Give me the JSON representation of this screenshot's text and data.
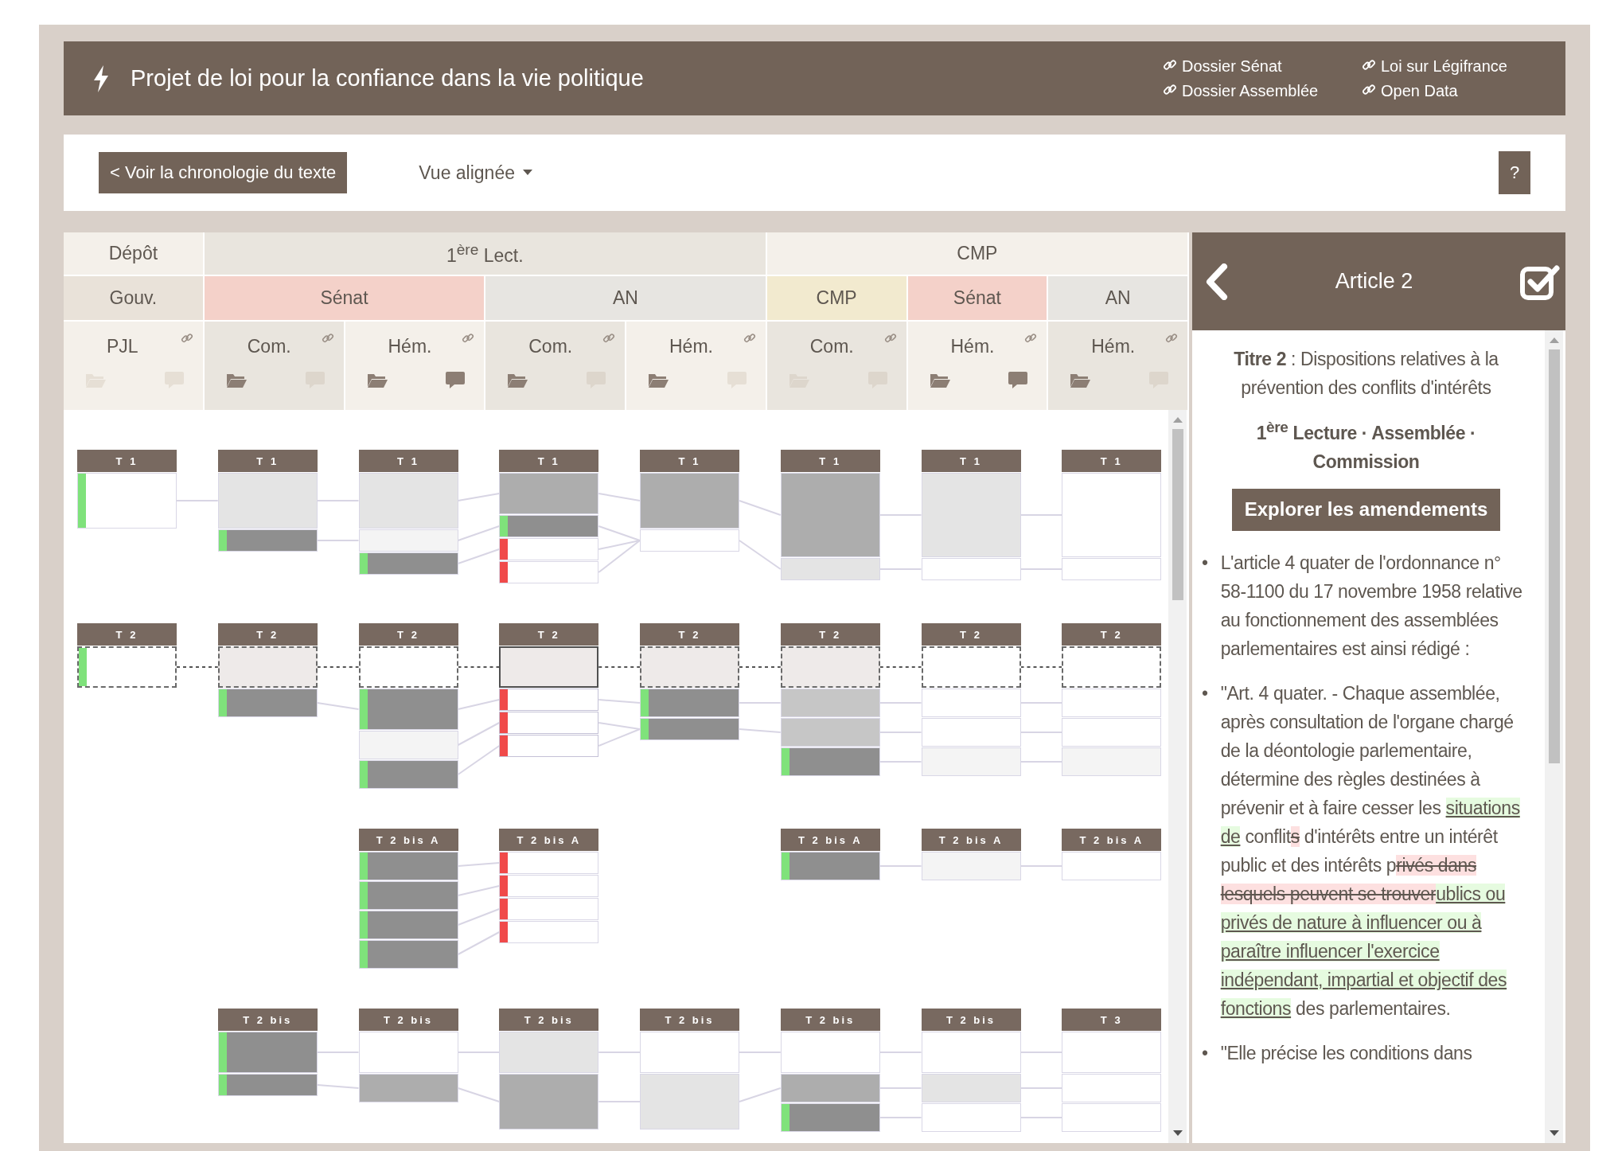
{
  "header": {
    "title": "Projet de loi pour la confiance dans la vie politique",
    "links": [
      "Dossier Sénat",
      "Loi sur Légifrance",
      "Dossier Assemblée",
      "Open Data"
    ]
  },
  "toolbar": {
    "back_button": "< Voir la chronologie du texte",
    "view_menu": "Vue alignée",
    "help_button": "?"
  },
  "phases": [
    {
      "label": "Dépôt",
      "chambers": [
        {
          "label": "Gouv.",
          "color": "#e9e2d9",
          "stages": [
            {
              "label": "PJL",
              "amendments": false,
              "comments": false
            }
          ]
        }
      ]
    },
    {
      "label": "1$^{ère}$ Lect.",
      "chambers": [
        {
          "label": "Sénat",
          "color": "#f4d1c9",
          "stages": [
            {
              "label": "Com.",
              "amendments": true,
              "comments": false
            },
            {
              "label": "Hém.",
              "amendments": true,
              "comments": true
            }
          ]
        },
        {
          "label": "AN",
          "color": "#e7e5e1",
          "stages": [
            {
              "label": "Com.",
              "amendments": true,
              "comments": false
            },
            {
              "label": "Hém.",
              "amendments": true,
              "comments": false
            }
          ]
        }
      ]
    },
    {
      "label": "CMP",
      "chambers": [
        {
          "label": "CMP",
          "color": "#f2eacf",
          "stages": [
            {
              "label": "Com.",
              "amendments": false,
              "comments": false
            }
          ]
        },
        {
          "label": "Sénat",
          "color": "#f4d1c9",
          "stages": [
            {
              "label": "Hém.",
              "amendments": true,
              "comments": true
            }
          ]
        },
        {
          "label": "AN",
          "color": "#e7e5e1",
          "stages": [
            {
              "label": "Hém.",
              "amendments": true,
              "comments": false
            }
          ]
        }
      ]
    }
  ],
  "diagram": {
    "groups": [
      {
        "blocks": [
          {
            "kind": "article",
            "label": "T 1",
            "selected": false,
            "segments": [
              {
                "kind": "xlong",
                "color": "#ffffff",
                "added": true,
                "removed": false
              }
            ]
          },
          {
            "kind": "article",
            "label": "T 1",
            "selected": false,
            "segments": [
              {
                "kind": "xlong",
                "color": "#e4e4e4",
                "added": false,
                "removed": false
              },
              {
                "kind": "short",
                "color": "#8f8f8f",
                "added": true,
                "removed": false
              }
            ]
          },
          {
            "kind": "article",
            "label": "T 1",
            "selected": false,
            "segments": [
              {
                "kind": "xlong",
                "color": "#e4e4e4",
                "added": false,
                "removed": false
              },
              {
                "kind": "short",
                "color": "#f4f4f4",
                "added": false,
                "removed": false
              },
              {
                "kind": "short",
                "color": "#8f8f8f",
                "added": true,
                "removed": false
              }
            ]
          },
          {
            "kind": "article",
            "label": "T 1",
            "selected": false,
            "segments": [
              {
                "kind": "long",
                "color": "#adadad",
                "added": false,
                "removed": false
              },
              {
                "kind": "short",
                "color": "#8f8f8f",
                "added": true,
                "removed": false
              },
              {
                "kind": "short",
                "color": "#ffffff",
                "added": false,
                "removed": true
              },
              {
                "kind": "short",
                "color": "#ffffff",
                "added": false,
                "removed": true
              }
            ]
          },
          {
            "kind": "article",
            "label": "T 1",
            "selected": false,
            "segments": [
              {
                "kind": "xlong",
                "color": "#adadad",
                "added": false,
                "removed": false
              },
              {
                "kind": "short",
                "color": "#ffffff",
                "added": false,
                "removed": false
              }
            ]
          },
          {
            "kind": "article",
            "label": "T 1",
            "selected": false,
            "segments": [
              {
                "kind": "xxlong",
                "color": "#adadad",
                "added": false,
                "removed": false
              },
              {
                "kind": "short",
                "color": "#e4e4e4",
                "added": false,
                "removed": false
              }
            ]
          },
          {
            "kind": "article",
            "label": "T 1",
            "selected": false,
            "segments": [
              {
                "kind": "xxlong",
                "color": "#e4e4e4",
                "added": false,
                "removed": false
              },
              {
                "kind": "short",
                "color": "#ffffff",
                "added": false,
                "removed": false
              }
            ]
          },
          {
            "kind": "article",
            "label": "T 1",
            "selected": false,
            "segments": [
              {
                "kind": "xxlong",
                "color": "#ffffff",
                "added": false,
                "removed": false
              },
              {
                "kind": "short",
                "color": "#ffffff",
                "added": false,
                "removed": false
              }
            ]
          }
        ]
      },
      {
        "blocks": [
          {
            "kind": "article",
            "label": "T 2",
            "selected": false,
            "segments": [
              {
                "kind": "title",
                "color": "#ffffff",
                "added": true,
                "removed": false
              }
            ]
          },
          {
            "kind": "article",
            "label": "T 2",
            "selected": false,
            "segments": [
              {
                "kind": "title",
                "color": "#eeeae9",
                "added": false,
                "removed": false
              },
              {
                "kind": "medium",
                "color": "#8f8f8f",
                "added": true,
                "removed": false
              }
            ]
          },
          {
            "kind": "article",
            "label": "T 2",
            "selected": false,
            "segments": [
              {
                "kind": "title",
                "color": "#ffffff",
                "added": false,
                "removed": false
              },
              {
                "kind": "long",
                "color": "#8f8f8f",
                "added": true,
                "removed": false
              },
              {
                "kind": "medium",
                "color": "#f4f4f4",
                "added": false,
                "removed": false
              },
              {
                "kind": "medium",
                "color": "#8f8f8f",
                "added": true,
                "removed": false
              }
            ]
          },
          {
            "kind": "article",
            "label": "T 2",
            "selected": true,
            "segments": [
              {
                "kind": "title",
                "color": "#eeeae9",
                "added": false,
                "removed": false
              },
              {
                "kind": "short",
                "color": "#ffffff",
                "added": false,
                "removed": true
              },
              {
                "kind": "short",
                "color": "#ffffff",
                "added": false,
                "removed": true
              },
              {
                "kind": "short",
                "color": "#ffffff",
                "added": false,
                "removed": true
              }
            ]
          },
          {
            "kind": "article",
            "label": "T 2",
            "selected": false,
            "segments": [
              {
                "kind": "title",
                "color": "#eeeae9",
                "added": false,
                "removed": false
              },
              {
                "kind": "medium",
                "color": "#8f8f8f",
                "added": true,
                "removed": false
              },
              {
                "kind": "short",
                "color": "#8f8f8f",
                "added": true,
                "removed": false
              }
            ]
          },
          {
            "kind": "article",
            "label": "T 2",
            "selected": false,
            "segments": [
              {
                "kind": "title",
                "color": "#eeeae9",
                "added": false,
                "removed": false
              },
              {
                "kind": "medium",
                "color": "#c6c6c6",
                "added": false,
                "removed": false
              },
              {
                "kind": "medium",
                "color": "#c6c6c6",
                "added": false,
                "removed": false
              },
              {
                "kind": "medium",
                "color": "#8f8f8f",
                "added": true,
                "removed": false
              }
            ]
          },
          {
            "kind": "article",
            "label": "T 2",
            "selected": false,
            "segments": [
              {
                "kind": "title",
                "color": "#ffffff",
                "added": false,
                "removed": false
              },
              {
                "kind": "medium",
                "color": "#ffffff",
                "added": false,
                "removed": false
              },
              {
                "kind": "medium",
                "color": "#ffffff",
                "added": false,
                "removed": false
              },
              {
                "kind": "medium",
                "color": "#f4f4f4",
                "added": false,
                "removed": false
              }
            ]
          },
          {
            "kind": "article",
            "label": "T 2",
            "selected": false,
            "segments": [
              {
                "kind": "title",
                "color": "#ffffff",
                "added": false,
                "removed": false
              },
              {
                "kind": "medium",
                "color": "#ffffff",
                "added": false,
                "removed": false
              },
              {
                "kind": "medium",
                "color": "#ffffff",
                "added": false,
                "removed": false
              },
              {
                "kind": "medium",
                "color": "#f4f4f4",
                "added": false,
                "removed": false
              }
            ]
          }
        ]
      },
      {
        "blocks": [
          {
            "kind": "gap"
          },
          {
            "kind": "gap"
          },
          {
            "kind": "article",
            "label": "T 2 bis A",
            "selected": false,
            "segments": [
              {
                "kind": "medium",
                "color": "#8f8f8f",
                "added": true,
                "removed": false
              },
              {
                "kind": "medium",
                "color": "#8f8f8f",
                "added": true,
                "removed": false
              },
              {
                "kind": "medium",
                "color": "#8f8f8f",
                "added": true,
                "removed": false
              },
              {
                "kind": "medium",
                "color": "#8f8f8f",
                "added": true,
                "removed": false
              }
            ]
          },
          {
            "kind": "article",
            "label": "T 2 bis A",
            "selected": false,
            "segments": [
              {
                "kind": "short",
                "color": "#ffffff",
                "added": false,
                "removed": true
              },
              {
                "kind": "short",
                "color": "#ffffff",
                "added": false,
                "removed": true
              },
              {
                "kind": "short",
                "color": "#ffffff",
                "added": false,
                "removed": true
              },
              {
                "kind": "short",
                "color": "#ffffff",
                "added": false,
                "removed": true
              }
            ]
          },
          {
            "kind": "gap"
          },
          {
            "kind": "article",
            "label": "T 2 bis A",
            "selected": false,
            "segments": [
              {
                "kind": "medium",
                "color": "#8f8f8f",
                "added": true,
                "removed": false
              }
            ]
          },
          {
            "kind": "article",
            "label": "T 2 bis A",
            "selected": false,
            "segments": [
              {
                "kind": "medium",
                "color": "#f4f4f4",
                "added": false,
                "removed": false
              }
            ]
          },
          {
            "kind": "article",
            "label": "T 2 bis A",
            "selected": false,
            "segments": [
              {
                "kind": "medium",
                "color": "#ffffff",
                "added": false,
                "removed": false
              }
            ]
          }
        ]
      },
      {
        "blocks": [
          {
            "kind": "gap"
          },
          {
            "kind": "article",
            "label": "T 2 bis",
            "selected": false,
            "segments": [
              {
                "kind": "long",
                "color": "#8f8f8f",
                "added": true,
                "removed": false
              },
              {
                "kind": "short",
                "color": "#8f8f8f",
                "added": true,
                "removed": false
              }
            ]
          },
          {
            "kind": "article",
            "label": "T 2 bis",
            "selected": false,
            "segments": [
              {
                "kind": "long",
                "color": "#ffffff",
                "added": false,
                "removed": false
              },
              {
                "kind": "medium",
                "color": "#adadad",
                "added": false,
                "removed": false
              }
            ]
          },
          {
            "kind": "article",
            "label": "T 2 bis",
            "selected": false,
            "segments": [
              {
                "kind": "long",
                "color": "#e4e4e4",
                "added": false,
                "removed": false
              },
              {
                "kind": "xlong",
                "color": "#adadad",
                "added": false,
                "removed": false
              }
            ]
          },
          {
            "kind": "article",
            "label": "T 2 bis",
            "selected": false,
            "segments": [
              {
                "kind": "long",
                "color": "#ffffff",
                "added": false,
                "removed": false
              },
              {
                "kind": "xlong",
                "color": "#e4e4e4",
                "added": false,
                "removed": false
              }
            ]
          },
          {
            "kind": "article",
            "label": "T 2 bis",
            "selected": false,
            "segments": [
              {
                "kind": "long",
                "color": "#ffffff",
                "added": false,
                "removed": false
              },
              {
                "kind": "medium",
                "color": "#adadad",
                "added": false,
                "removed": false
              },
              {
                "kind": "medium",
                "color": "#8f8f8f",
                "added": true,
                "removed": false
              }
            ]
          },
          {
            "kind": "article",
            "label": "T 2 bis",
            "selected": false,
            "segments": [
              {
                "kind": "long",
                "color": "#ffffff",
                "added": false,
                "removed": false
              },
              {
                "kind": "medium",
                "color": "#e4e4e4",
                "added": false,
                "removed": false
              },
              {
                "kind": "medium",
                "color": "#ffffff",
                "added": false,
                "removed": false
              }
            ]
          },
          {
            "kind": "article",
            "label": "T 3",
            "selected": false,
            "segments": [
              {
                "kind": "long",
                "color": "#ffffff",
                "added": false,
                "removed": false
              },
              {
                "kind": "medium",
                "color": "#ffffff",
                "added": false,
                "removed": false
              },
              {
                "kind": "medium",
                "color": "#ffffff",
                "added": false,
                "removed": false
              }
            ]
          }
        ]
      }
    ]
  },
  "panel": {
    "title": "Article 2",
    "heading": "**Titre 2** : Dispositions relatives à la prévention des conflits d'intérêts",
    "stage": "1$^{ère}$ Lecture · Assemblée · Commission",
    "button": "Explorer les amendements",
    "paragraphs": [
      {
        "bullet": "•",
        "parts": [
          {
            "kind": "same",
            "text": "L'article 4 quater de l'ordonnance n° 58-1100 du 17 novembre 1958 relative au fonctionnement des assemblées parlementaires est ainsi rédigé :"
          }
        ]
      },
      {
        "bullet": "•",
        "parts": [
          {
            "kind": "same",
            "text": "\"Art. 4 quater. - Chaque assemblée, après consultation de l'organe chargé de la déontologie parlementaire, détermine des règles destinées à prévenir et à faire cesser les "
          },
          {
            "kind": "added",
            "text": "situations de"
          },
          {
            "kind": "same",
            "text": " conflit"
          },
          {
            "kind": "removed",
            "text": "s"
          },
          {
            "kind": "same",
            "text": " d'intérêts entre un intérêt public et des intérêts p"
          },
          {
            "kind": "removed",
            "text": "rivés dans lesquels peuvent se trouver"
          },
          {
            "kind": "added",
            "text": "ublics ou privés de nature à influencer ou à paraître influencer l'exercice indépendant, impartial et objectif des fonctions"
          },
          {
            "kind": "same",
            "text": " des parlementaires."
          }
        ]
      },
      {
        "bullet": "•",
        "parts": [
          {
            "kind": "same",
            "text": "\"Elle précise les conditions dans"
          }
        ]
      }
    ]
  }
}
